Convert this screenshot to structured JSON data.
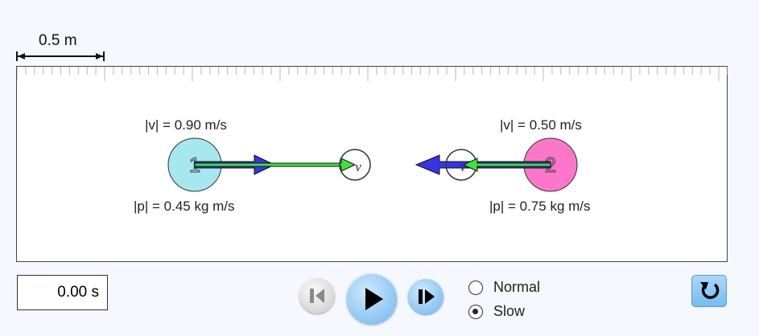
{
  "scale": {
    "label": "0.5 m"
  },
  "balls": [
    {
      "number": "1",
      "color": "#a7e7ef",
      "velocity_label": "|v| = 0.90 m/s",
      "momentum_label": "|p| = 0.45 kg m/s"
    },
    {
      "number": "2",
      "color": "#fc77c9",
      "velocity_label": "|v| = 0.50 m/s",
      "momentum_label": "|p| = 0.75 kg m/s"
    }
  ],
  "velocity_handle_glyph": "v",
  "time": {
    "display": "0.00 s"
  },
  "speed_options": [
    {
      "label": "Normal",
      "selected": false
    },
    {
      "label": "Slow",
      "selected": true
    }
  ],
  "colors": {
    "momentum_arrow": "#3535e8",
    "velocity_arrow": "#3be53b",
    "play_button": "#6fb5ec"
  },
  "icons": {
    "step_back": "step-back-icon",
    "play": "play-icon",
    "step_forward": "step-forward-icon",
    "reset": "reset-icon"
  }
}
